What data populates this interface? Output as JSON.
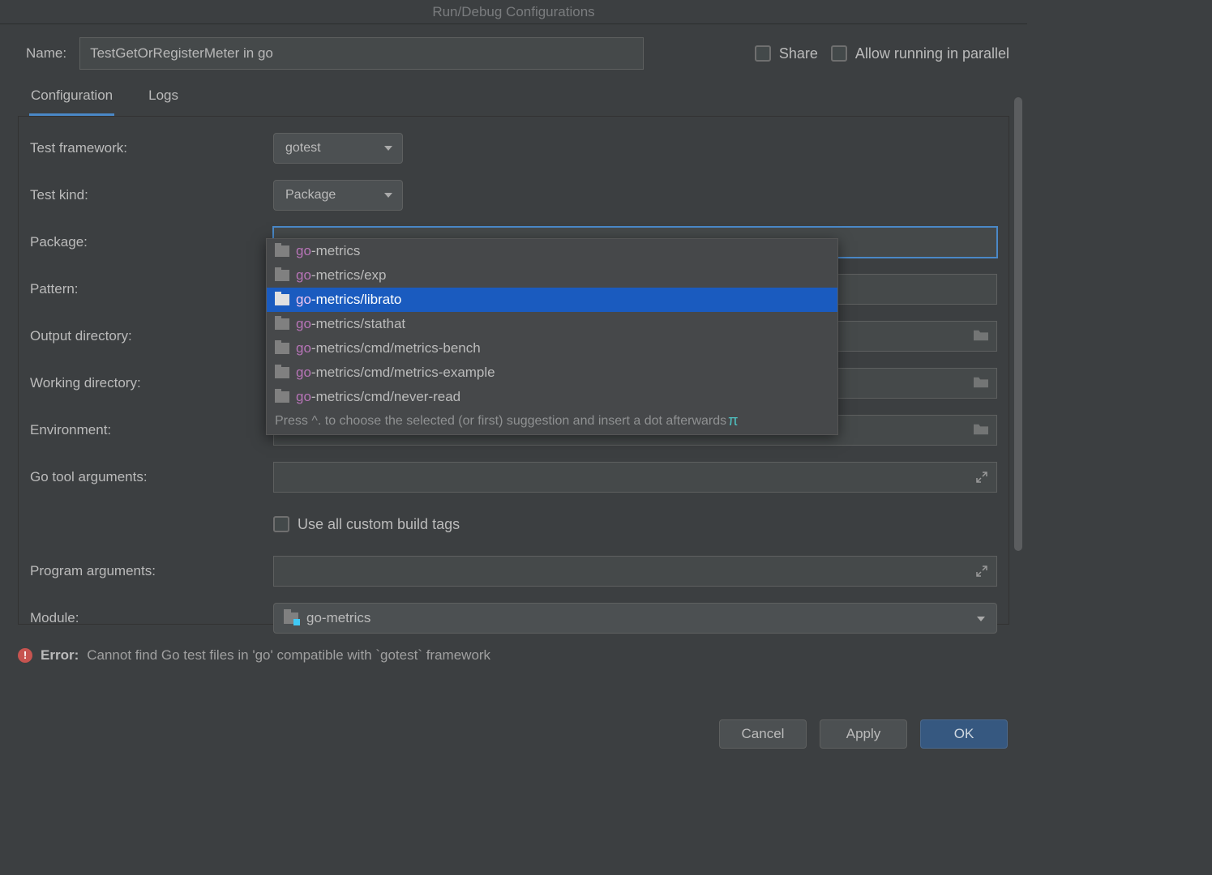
{
  "title": "Run/Debug Configurations",
  "name_label": "Name:",
  "name_value": "TestGetOrRegisterMeter in go",
  "share_label": "Share",
  "parallel_label": "Allow running in parallel",
  "tabs": {
    "configuration": "Configuration",
    "logs": "Logs"
  },
  "form": {
    "test_framework_label": "Test framework:",
    "test_framework_value": "gotest",
    "test_kind_label": "Test kind:",
    "test_kind_value": "Package",
    "package_label": "Package:",
    "package_value": "go",
    "pattern_label": "Pattern:",
    "output_dir_label": "Output directory:",
    "working_dir_label": "Working directory:",
    "environment_label": "Environment:",
    "go_tool_args_label": "Go tool arguments:",
    "use_custom_tags_label": "Use all custom build tags",
    "program_args_label": "Program arguments:",
    "module_label": "Module:",
    "module_value": "go-metrics"
  },
  "autocomplete": {
    "prefix": "go",
    "items": [
      {
        "tail": "-metrics",
        "selected": false
      },
      {
        "tail": "-metrics/exp",
        "selected": false
      },
      {
        "tail": "-metrics/librato",
        "selected": true
      },
      {
        "tail": "-metrics/stathat",
        "selected": false
      },
      {
        "tail": "-metrics/cmd/metrics-bench",
        "selected": false
      },
      {
        "tail": "-metrics/cmd/metrics-example",
        "selected": false
      },
      {
        "tail": "-metrics/cmd/never-read",
        "selected": false
      }
    ],
    "hint": "Press ^. to choose the selected (or first) suggestion and insert a dot afterwards",
    "hint_symbol": "π"
  },
  "error": {
    "label": "Error:",
    "message": "Cannot find Go test files in 'go' compatible with `gotest` framework"
  },
  "buttons": {
    "cancel": "Cancel",
    "apply": "Apply",
    "ok": "OK"
  }
}
